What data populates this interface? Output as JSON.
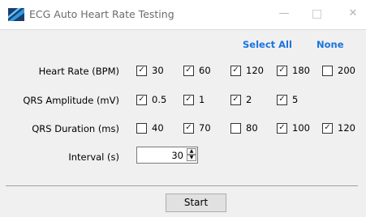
{
  "window": {
    "title": "ECG Auto Heart Rate Testing",
    "controls": {
      "minimize": "—",
      "close": "✕"
    }
  },
  "links": {
    "select_all": "Select All",
    "none": "None"
  },
  "rows": [
    {
      "label": "Heart Rate (BPM)",
      "options": [
        {
          "label": "30",
          "checked": true
        },
        {
          "label": "60",
          "checked": true
        },
        {
          "label": "120",
          "checked": true
        },
        {
          "label": "180",
          "checked": true
        },
        {
          "label": "200",
          "checked": false
        }
      ]
    },
    {
      "label": "QRS Amplitude (mV)",
      "options": [
        {
          "label": "0.5",
          "checked": true
        },
        {
          "label": "1",
          "checked": true
        },
        {
          "label": "2",
          "checked": true
        },
        {
          "label": "5",
          "checked": true
        }
      ]
    },
    {
      "label": "QRS Duration (ms)",
      "options": [
        {
          "label": "40",
          "checked": false
        },
        {
          "label": "70",
          "checked": true
        },
        {
          "label": "80",
          "checked": false
        },
        {
          "label": "100",
          "checked": true
        },
        {
          "label": "120",
          "checked": true
        }
      ]
    }
  ],
  "interval": {
    "label": "Interval (s)",
    "value": "30"
  },
  "start_button": "Start",
  "colors": {
    "link": "#1a74e0",
    "background": "#f0f0f0",
    "titlebar": "#ffffff"
  }
}
